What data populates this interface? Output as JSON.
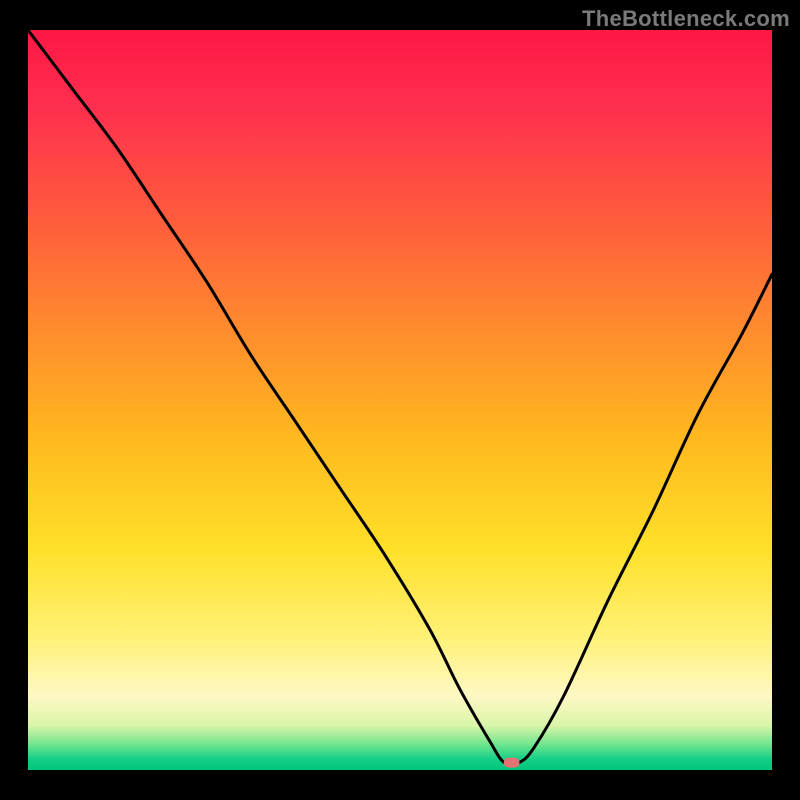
{
  "watermark": "TheBottleneck.com",
  "chart_data": {
    "type": "line",
    "title": "",
    "xlabel": "",
    "ylabel": "",
    "xlim": [
      0,
      100
    ],
    "ylim": [
      0,
      100
    ],
    "grid": false,
    "legend": false,
    "marker": {
      "x": 65,
      "y": 1,
      "color": "#e57373"
    },
    "series": [
      {
        "name": "bottleneck-curve",
        "x": [
          0,
          6,
          12,
          18,
          24,
          30,
          36,
          42,
          48,
          54,
          58,
          62,
          64,
          66,
          68,
          72,
          78,
          84,
          90,
          96,
          100
        ],
        "y": [
          100,
          92,
          84,
          75,
          66,
          56,
          47,
          38,
          29,
          19,
          11,
          4,
          1,
          1,
          3,
          10,
          23,
          35,
          48,
          59,
          67
        ]
      }
    ],
    "background_gradient": {
      "stops": [
        {
          "offset": 0.0,
          "color": "#ff1744"
        },
        {
          "offset": 0.1,
          "color": "#ff2e4f"
        },
        {
          "offset": 0.25,
          "color": "#ff5a3d"
        },
        {
          "offset": 0.4,
          "color": "#ff8a2e"
        },
        {
          "offset": 0.55,
          "color": "#ffb81f"
        },
        {
          "offset": 0.7,
          "color": "#ffe028"
        },
        {
          "offset": 0.82,
          "color": "#fff176"
        },
        {
          "offset": 0.9,
          "color": "#fff8c4"
        },
        {
          "offset": 0.94,
          "color": "#d9f5a8"
        },
        {
          "offset": 0.965,
          "color": "#72e58f"
        },
        {
          "offset": 0.985,
          "color": "#15d087"
        },
        {
          "offset": 1.0,
          "color": "#00c57a"
        }
      ]
    }
  }
}
